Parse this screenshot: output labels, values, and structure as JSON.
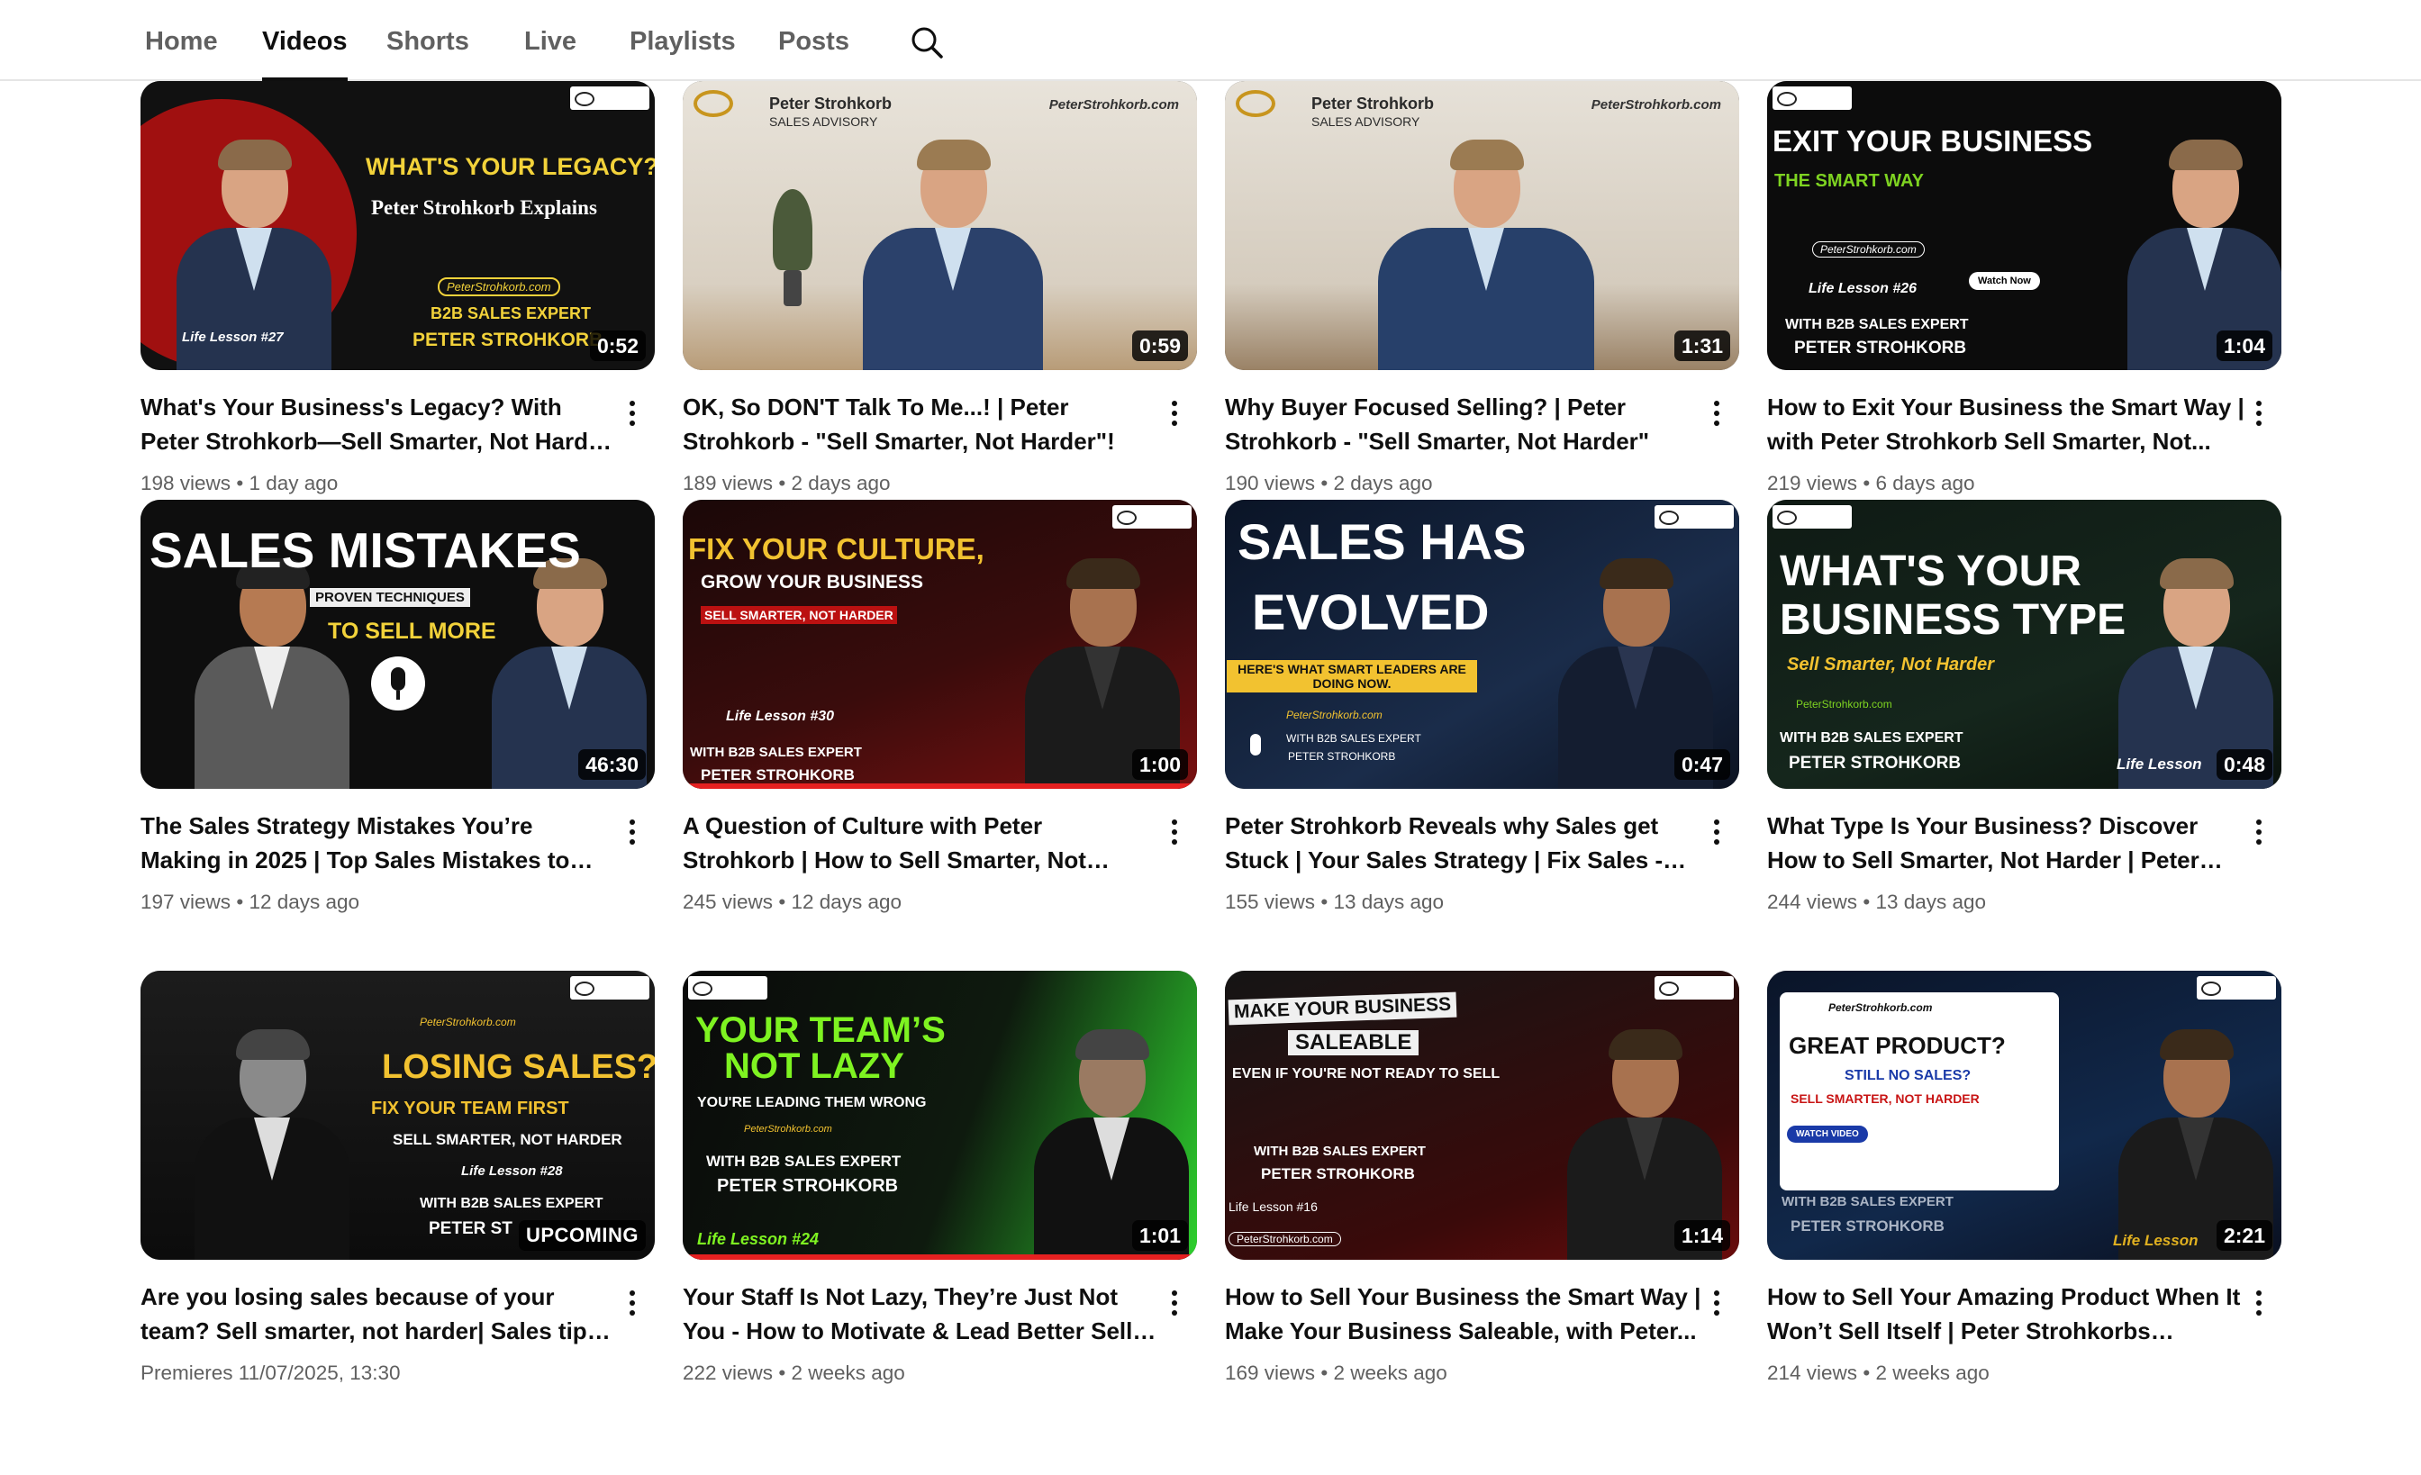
{
  "tabs": [
    {
      "label": "Home",
      "active": false
    },
    {
      "label": "Videos",
      "active": true
    },
    {
      "label": "Shorts",
      "active": false
    },
    {
      "label": "Live",
      "active": false
    },
    {
      "label": "Playlists",
      "active": false
    },
    {
      "label": "Posts",
      "active": false
    }
  ],
  "search_icon": "search-icon",
  "videos": [
    {
      "title": "What's Your Business's Legacy? With Peter Strohkorb—Sell Smarter, Not Harder | Sell...",
      "duration": "0:52",
      "views": "198 views",
      "age": "1 day ago",
      "thumb": {
        "t1": "WHAT'S YOUR LEGACY?",
        "t2": "Peter Strohkorb Explains",
        "t3": "PeterStrohkorb.com",
        "t4": "B2B SALES EXPERT",
        "t5": "PETER STROHKORB",
        "t6": "Life Lesson #27"
      }
    },
    {
      "title": "OK, So DON'T Talk To Me...! | Peter Strohkorb - \"Sell Smarter, Not Harder\"!",
      "duration": "0:59",
      "views": "189 views",
      "age": "2 days ago",
      "thumb": {
        "t1": "Peter Strohkorb",
        "t2": "SALES ADVISORY",
        "t3": "PeterStrohkorb.com"
      }
    },
    {
      "title": "Why Buyer Focused Selling? | Peter Strohkorb - \"Sell Smarter, Not Harder\"",
      "duration": "1:31",
      "views": "190 views",
      "age": "2 days ago",
      "thumb": {
        "t1": "Peter Strohkorb",
        "t2": "SALES ADVISORY",
        "t3": "PeterStrohkorb.com"
      }
    },
    {
      "title": "How to Exit Your Business the Smart Way | with Peter Strohkorb Sell Smarter, Not...",
      "duration": "1:04",
      "views": "219 views",
      "age": "6 days ago",
      "thumb": {
        "t1": "EXIT YOUR BUSINESS",
        "t2": "THE SMART WAY",
        "t3": "PeterStrohkorb.com",
        "t4": "Life Lesson #26",
        "t5": "Watch Now",
        "t6": "WITH B2B SALES EXPERT",
        "t7": "PETER STROHKORB"
      }
    },
    {
      "title": "The Sales Strategy Mistakes You’re Making in 2025 | Top Sales Mistakes to Avoid & Ho...",
      "duration": "46:30",
      "views": "197 views",
      "age": "12 days ago",
      "thumb": {
        "t1": "SALES MISTAKES",
        "t2": "PROVEN TECHNIQUES",
        "t3": "TO SELL MORE"
      }
    },
    {
      "title": "A Question of Culture with Peter Strohkorb | How to Sell Smarter, Not Harder in Today...",
      "duration": "1:00",
      "views": "245 views",
      "age": "12 days ago",
      "thumb": {
        "t1": "FIX YOUR CULTURE,",
        "t2": "GROW YOUR BUSINESS",
        "t3": "SELL SMARTER, NOT HARDER",
        "t4": "Life Lesson #30",
        "t5": "WITH B2B SALES EXPERT",
        "t6": "PETER STROHKORB"
      }
    },
    {
      "title": "Peter Strohkorb Reveals why Sales get Stuck | Your Sales Strategy | Fix Sales - Smarter,...",
      "duration": "0:47",
      "views": "155 views",
      "age": "13 days ago",
      "thumb": {
        "t1": "SALES HAS",
        "t2": "EVOLVED",
        "t3": "HERE'S WHAT SMART LEADERS ARE DOING NOW.",
        "t4": "PeterStrohkorb.com",
        "t5": "WITH B2B SALES EXPERT",
        "t6": "PETER STROHKORB"
      }
    },
    {
      "title": "What Type Is Your Business? Discover How to Sell Smarter, Not Harder | Peter Strohkor...",
      "duration": "0:48",
      "views": "244 views",
      "age": "13 days ago",
      "thumb": {
        "t1": "WHAT'S YOUR",
        "t2": "BUSINESS TYPE",
        "t3": "Sell Smarter, Not Harder",
        "t4": "PeterStrohkorb.com",
        "t5": "WITH B2B SALES EXPERT",
        "t6": "PETER STROHKORB",
        "t7": "Life Lesson"
      }
    },
    {
      "title": "Are you losing sales because of your team? Sell smarter, not harder| Sales tips with Pet...",
      "duration": "UPCOMING",
      "views": "Premieres 11/07/2025, 13:30",
      "age": "",
      "thumb": {
        "t1": "PeterStrohkorb.com",
        "t2": "LOSING SALES?",
        "t3": "FIX YOUR TEAM FIRST",
        "t4": "SELL SMARTER, NOT HARDER",
        "t5": "Life Lesson #28",
        "t6": "WITH B2B SALES EXPERT",
        "t7": "PETER ST"
      }
    },
    {
      "title": "Your Staff Is Not Lazy, They’re Just Not You - How to Motivate & Lead Better Sell | Peter...",
      "duration": "1:01",
      "views": "222 views",
      "age": "2 weeks ago",
      "thumb": {
        "t1": "YOUR TEAM’S",
        "t2": "NOT LAZY",
        "t3": "YOU'RE LEADING THEM WRONG",
        "t4": "PeterStrohkorb.com",
        "t5": "WITH B2B SALES EXPERT",
        "t6": "PETER STROHKORB",
        "t7": "Life Lesson #24"
      }
    },
    {
      "title": "How to Sell Your Business the Smart Way | Make Your Business Saleable, with Peter...",
      "duration": "1:14",
      "views": "169 views",
      "age": "2 weeks ago",
      "thumb": {
        "t1": "MAKE YOUR BUSINESS",
        "t2": "SALEABLE",
        "t3": "EVEN IF YOU'RE NOT READY TO SELL",
        "t4": "WITH B2B SALES EXPERT",
        "t5": "PETER STROHKORB",
        "t6": "Life Lesson #16",
        "t7": "PeterStrohkorb.com"
      }
    },
    {
      "title": "How to Sell Your Amazing Product When It Won’t Sell Itself | Peter Strohkorbs Expert...",
      "duration": "2:21",
      "views": "214 views",
      "age": "2 weeks ago",
      "thumb": {
        "t1": "PeterStrohkorb.com",
        "t2": "GREAT PRODUCT?",
        "t3": "STILL NO SALES?",
        "t4": "SELL SMARTER, NOT HARDER",
        "t5": "WATCH VIDEO",
        "t6": "WITH B2B SALES EXPERT",
        "t7": "PETER STROHKORB",
        "t8": "Life Lesson"
      }
    }
  ]
}
